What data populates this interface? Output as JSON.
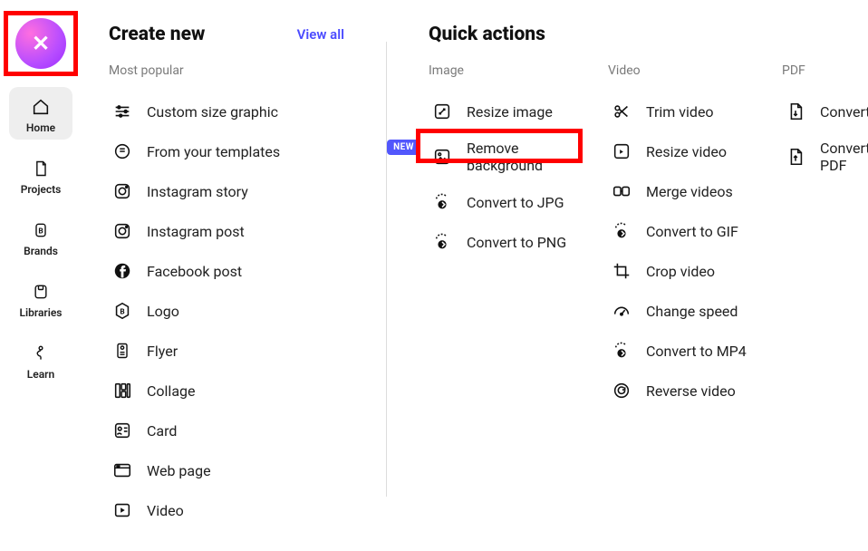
{
  "sidebar": {
    "close_glyph": "✕",
    "items": [
      {
        "id": "home",
        "label": "Home"
      },
      {
        "id": "projects",
        "label": "Projects"
      },
      {
        "id": "brands",
        "label": "Brands"
      },
      {
        "id": "libraries",
        "label": "Libraries"
      },
      {
        "id": "learn",
        "label": "Learn"
      }
    ]
  },
  "create": {
    "title": "Create new",
    "view_all": "View all",
    "sub": "Most popular",
    "new_badge": "NEW",
    "items": [
      {
        "id": "custom-size",
        "label": "Custom size graphic"
      },
      {
        "id": "from-templates",
        "label": "From your templates",
        "badge": true
      },
      {
        "id": "ig-story",
        "label": "Instagram story"
      },
      {
        "id": "ig-post",
        "label": "Instagram post"
      },
      {
        "id": "fb-post",
        "label": "Facebook post"
      },
      {
        "id": "logo",
        "label": "Logo"
      },
      {
        "id": "flyer",
        "label": "Flyer"
      },
      {
        "id": "collage",
        "label": "Collage"
      },
      {
        "id": "card",
        "label": "Card"
      },
      {
        "id": "web-page",
        "label": "Web page"
      },
      {
        "id": "video",
        "label": "Video"
      }
    ]
  },
  "quick": {
    "title": "Quick actions",
    "columns": {
      "image": {
        "title": "Image",
        "items": [
          {
            "id": "resize-image",
            "label": "Resize image"
          },
          {
            "id": "remove-bg",
            "label": "Remove background"
          },
          {
            "id": "to-jpg",
            "label": "Convert to JPG"
          },
          {
            "id": "to-png",
            "label": "Convert to PNG"
          }
        ]
      },
      "video": {
        "title": "Video",
        "items": [
          {
            "id": "trim-video",
            "label": "Trim video"
          },
          {
            "id": "resize-video",
            "label": "Resize video"
          },
          {
            "id": "merge-videos",
            "label": "Merge videos"
          },
          {
            "id": "to-gif",
            "label": "Convert to GIF"
          },
          {
            "id": "crop-video",
            "label": "Crop video"
          },
          {
            "id": "change-speed",
            "label": "Change speed"
          },
          {
            "id": "to-mp4",
            "label": "Convert to MP4"
          },
          {
            "id": "reverse-video",
            "label": "Reverse video"
          }
        ]
      },
      "pdf": {
        "title": "PDF",
        "items": [
          {
            "id": "to-pdf",
            "label": "Convert to PDF"
          },
          {
            "id": "from-pdf",
            "label": "Convert from PDF"
          }
        ]
      }
    }
  }
}
